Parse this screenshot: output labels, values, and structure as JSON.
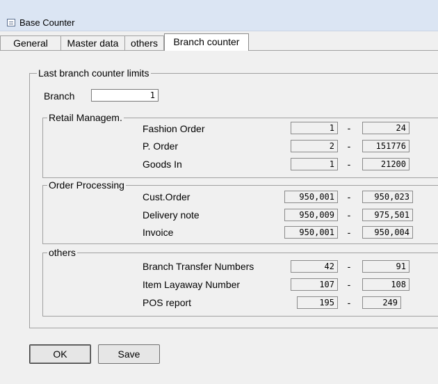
{
  "window": {
    "title": "Base Counter"
  },
  "tabs": [
    {
      "label": "General"
    },
    {
      "label": "Master data"
    },
    {
      "label": "others"
    },
    {
      "label": "Branch counter",
      "active": true
    }
  ],
  "limits": {
    "title": "Last branch counter limits",
    "branch_label": "Branch",
    "branch_value": "1",
    "separator": "-",
    "groups": [
      {
        "title": "Retail Managem.",
        "rows": [
          {
            "label": "Fashion Order",
            "from": "1",
            "to": "24"
          },
          {
            "label": "P. Order",
            "from": "2",
            "to": "151776"
          },
          {
            "label": "Goods In",
            "from": "1",
            "to": "21200"
          }
        ]
      },
      {
        "title": "Order Processing",
        "rows": [
          {
            "label": "Cust.Order",
            "from": "950,001",
            "to": "950,023"
          },
          {
            "label": "Delivery note",
            "from": "950,009",
            "to": "975,501"
          },
          {
            "label": "Invoice",
            "from": "950,001",
            "to": "950,004"
          }
        ]
      },
      {
        "title": "others",
        "rows": [
          {
            "label": "Branch Transfer Numbers",
            "from": "42",
            "to": "91"
          },
          {
            "label": "Item Layaway Number",
            "from": "107",
            "to": "108"
          },
          {
            "label": "POS report",
            "from": "195",
            "to": "249"
          }
        ]
      }
    ]
  },
  "buttons": {
    "ok": "OK",
    "save": "Save"
  },
  "icons": {
    "window_icon": "window-form-icon"
  }
}
